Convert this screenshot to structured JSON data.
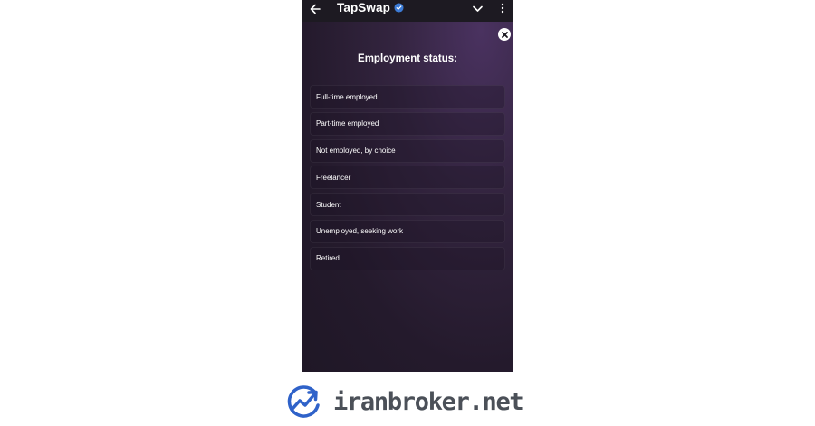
{
  "header": {
    "app_title": "TapSwap",
    "back_icon": "arrow-left-icon",
    "verified_icon": "verified-badge-icon",
    "chevron_icon": "chevron-down-icon",
    "menu_icon": "more-vertical-icon"
  },
  "dialog": {
    "close_icon": "close-icon",
    "heading": "Employment status:",
    "options": [
      {
        "label": "Full-time employed"
      },
      {
        "label": "Part-time employed"
      },
      {
        "label": "Not employed, by choice"
      },
      {
        "label": "Freelancer"
      },
      {
        "label": "Student"
      },
      {
        "label": "Unemployed, seeking work"
      },
      {
        "label": "Retired"
      }
    ]
  },
  "watermark": {
    "text": "iranbroker.net",
    "icon": "growth-chart-logo-icon"
  },
  "colors": {
    "accent_blue": "#3c7bd6",
    "topbar": "#1d1a22",
    "background": "#2a1f33"
  }
}
